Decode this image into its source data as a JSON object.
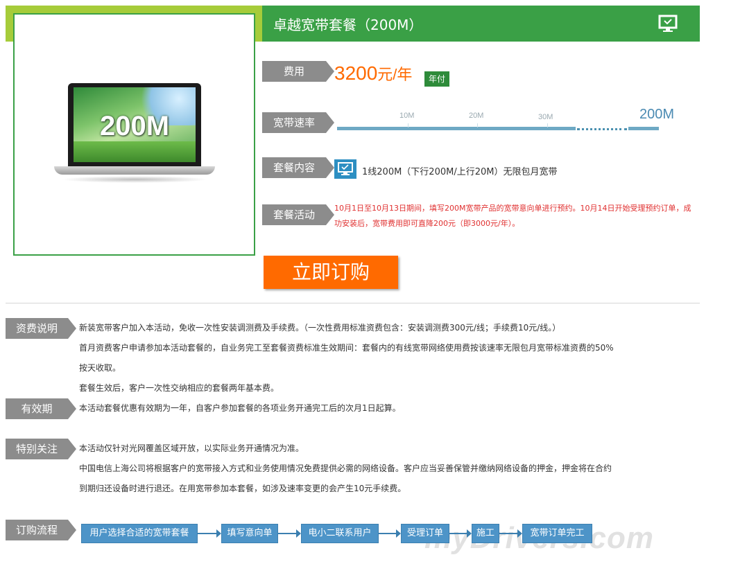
{
  "product": {
    "image_label": "200M",
    "title": "卓越宽带套餐（200M）",
    "icon": "monitor-icon"
  },
  "fee": {
    "label": "费用",
    "price": "3200",
    "unit": "元/年",
    "badge": "年付"
  },
  "speed": {
    "label": "宽带速率",
    "ticks": [
      "10M",
      "20M",
      "30M"
    ],
    "max": "200M"
  },
  "package": {
    "label": "套餐内容",
    "icon": "monitor-icon",
    "text": "1线200M（下行200M/上行20M）无限包月宽带"
  },
  "promo": {
    "label": "套餐活动",
    "text": "10月1日至10月13日期间，填写200M宽带产品的宽带意向单进行预约。10月14日开始受理预约订单，成功安装后，宽带费用即可直降200元（即3000元/年）。"
  },
  "buy_button": "立即订购",
  "sections": {
    "fee_desc": {
      "label": "资费说明",
      "lines": [
        "新装宽带客户加入本活动，免收一次性安装调测费及手续费。（一次性费用标准资费包含：安装调测费300元/线；手续费10元/线。）",
        "首月资费客户申请参加本活动套餐的，自业务完工至套餐资费标准生效期间：套餐内的有线宽带网络使用费按该速率无限包月宽带标准资费的50%",
        "按天收取。",
        "套餐生效后，客户一次性交纳相应的套餐两年基本费。"
      ]
    },
    "validity": {
      "label": "有效期",
      "lines": [
        "本活动套餐优惠有效期为一年，自客户参加套餐的各项业务开通完工后的次月1日起算。"
      ]
    },
    "notice": {
      "label": "特别关注",
      "lines": [
        "本活动仅针对光网覆盖区域开放，以实际业务开通情况为准。",
        "中国电信上海公司将根据客户的宽带接入方式和业务使用情况免费提供必需的网络设备。客户应当妥善保管并缴纳网络设备的押金，押金将在合约",
        "到期归还设备时进行退还。在用宽带参加本套餐，如涉及速率变更的会产生10元手续费。"
      ]
    },
    "flow": {
      "label": "订购流程",
      "steps": [
        "用户选择合适的宽带套餐",
        "填写意向单",
        "电小二联系用户",
        "受理订单",
        "施工",
        "宽带订单完工"
      ]
    }
  },
  "watermark": "myDrivers.com"
}
